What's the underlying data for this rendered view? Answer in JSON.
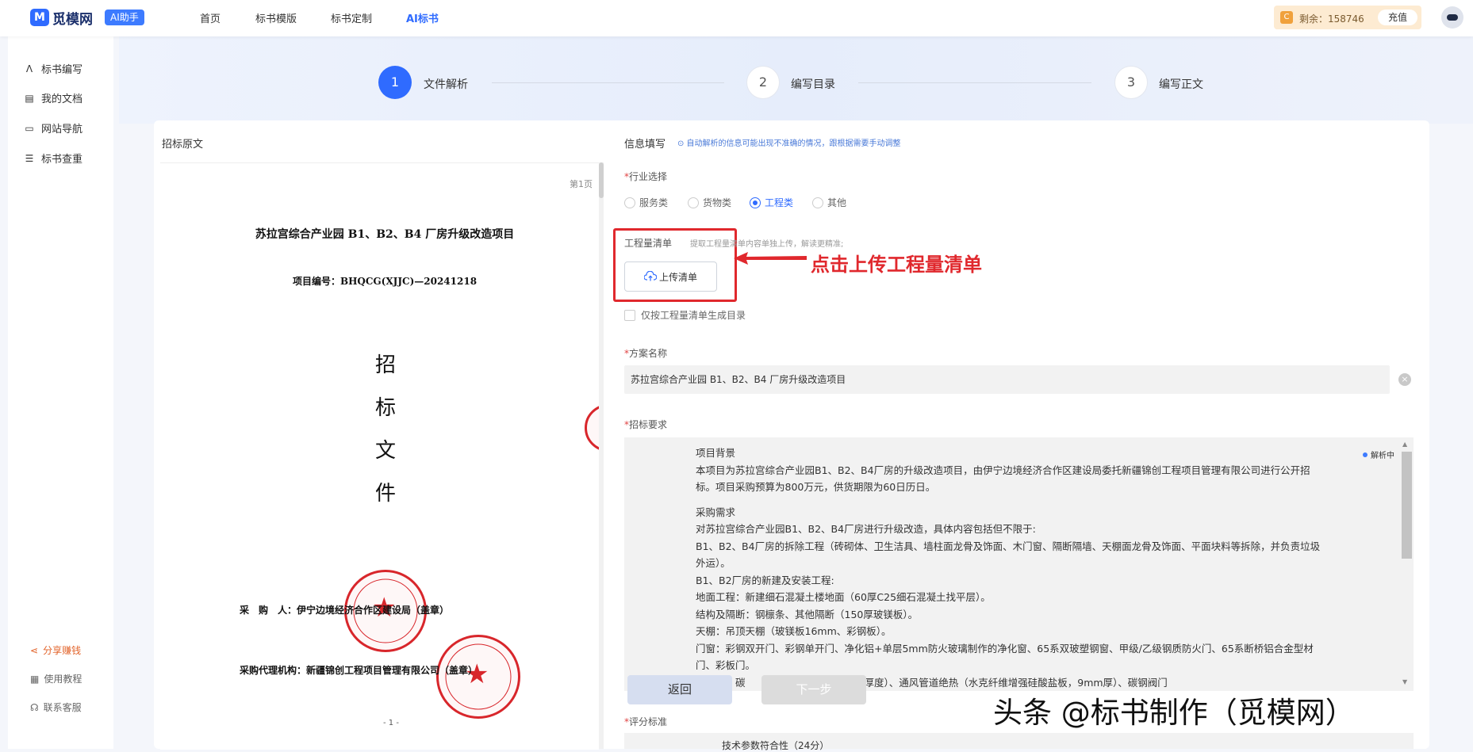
{
  "header": {
    "logo_mark": "M",
    "logo_text": "觅模网",
    "ai_badge": "AI助手",
    "nav": [
      "首页",
      "标书模版",
      "标书定制",
      "AI标书"
    ],
    "balance_icon": "C",
    "balance_label": "剩余：158746",
    "recharge": "充值"
  },
  "sidebar": {
    "items": [
      {
        "icon": "pen-icon",
        "label": "标书编写"
      },
      {
        "icon": "document-icon",
        "label": "我的文档"
      },
      {
        "icon": "monitor-icon",
        "label": "网站导航"
      },
      {
        "icon": "search-list-icon",
        "label": "标书查重"
      }
    ],
    "bottom": [
      {
        "icon": "share-icon",
        "label": "分享赚钱"
      },
      {
        "icon": "book-icon",
        "label": "使用教程"
      },
      {
        "icon": "headset-icon",
        "label": "联系客服"
      }
    ]
  },
  "steps": [
    {
      "num": "1",
      "label": "文件解析",
      "active": true
    },
    {
      "num": "2",
      "label": "编写目录",
      "active": false
    },
    {
      "num": "3",
      "label": "编写正文",
      "active": false
    }
  ],
  "left_panel": {
    "title": "招标原文",
    "page": "第1页",
    "doc_title": "苏拉宫综合产业园 B1、B2、B4 厂房升级改造项目",
    "doc_code": "项目编号：BHQCG(XJJC)—20241218",
    "big_chars": [
      "招",
      "标",
      "文",
      "件"
    ],
    "buyer": "采　购　人：伊宁边境经济合作区建设局（盖章）",
    "agent": "采购代理机构：新疆锦创工程项目管理有限公司（盖章）",
    "page_no": "- 1 -",
    "seal_text_1": "伊宁边境经济合作区建设局",
    "seal_text_2": "新疆锦创工程项目管理有限公司"
  },
  "right_panel": {
    "title": "信息填写",
    "hint": "⊙ 自动解析的信息可能出现不准确的情况，跟根据需要手动调整",
    "industry_label": "行业选择",
    "industries": [
      {
        "label": "服务类",
        "selected": false
      },
      {
        "label": "货物类",
        "selected": false
      },
      {
        "label": "工程类",
        "selected": true
      },
      {
        "label": "其他",
        "selected": false
      }
    ],
    "bill_label": "工程量清单",
    "bill_hint": "提取工程量清单内容单独上传，解读更精准;",
    "upload_label": "上传清单",
    "annotation": "点击上传工程量清单",
    "only_bill_label": "仅按工程量清单生成目录",
    "plan_label": "方案名称",
    "plan_value": "苏拉宫综合产业园 B1、B2、B4 厂房升级改造项目",
    "req_label": "招标要求",
    "parse_status": "解析中",
    "req_paragraphs": [
      "项目背景",
      "本项目为苏拉宫综合产业园B1、B2、B4厂房的升级改造项目，由伊宁边境经济合作区建设局委托新疆锦创工程项目管理有限公司进行公开招标。项目采购预算为800万元，供货期限为60日历日。",
      "",
      "采购需求",
      "对苏拉宫综合产业园B1、B2、B4厂房进行升级改造，具体内容包括但不限于:",
      "B1、B2、B4厂房的拆除工程（砖砌体、卫生洁具、墙柱面龙骨及饰面、木门窗、隔断隔墙、天棚面龙骨及饰面、平面块料等拆除，并负责垃圾外运）。",
      "B1、B2厂房的新建及安装工程:",
      "地面工程：新建细石混凝土楼地面（60厚C25细石混凝土找平层）。",
      "结构及隔断：钢檩条、其他隔断（150厚玻镁板）。",
      "天棚：吊顶天棚（玻镁板16mm、彩钢板）。",
      "门窗：彩钢双开门、彩钢单开门、净化铝+单层5mm防火玻璃制作的净化窗、65系双玻塑钢窗、甲级/乙级钢质防火门、65系断桥铝合金型材门、彩板门。",
      "　　程：碳　　　　　　长边长及板材厚度）、通风管道绝热（水克纤维增强硅酸盐板，9mm厚）、碳钢阀门"
    ],
    "back_label": "返回",
    "next_label": "下一步",
    "score_label": "评分标准",
    "score_partial": "技术参数符合性（24分）"
  },
  "watermark": "头条 @标书制作（觅模网）"
}
